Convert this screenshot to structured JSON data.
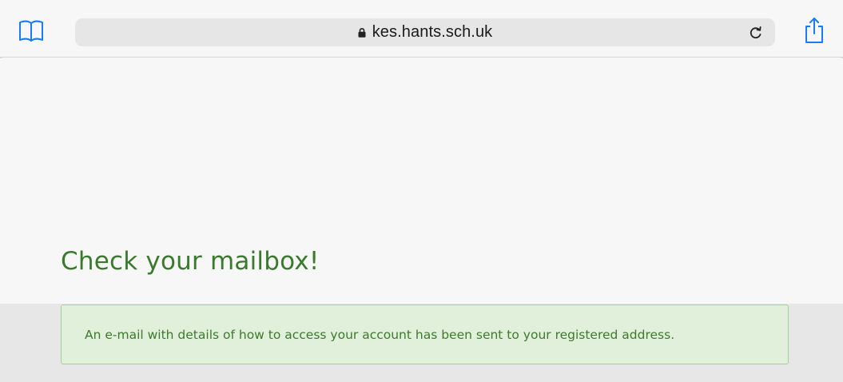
{
  "browser": {
    "url": "kes.hants.sch.uk",
    "icons": {
      "bookmarks": "book-icon",
      "lock": "lock-icon",
      "reload": "reload-icon",
      "share": "share-icon"
    },
    "accent_color": "#1a7cf5"
  },
  "page": {
    "heading": "Check your mailbox!",
    "alert": {
      "message": "An e-mail with details of how to access your account has been sent to your registered address.",
      "status": "success"
    },
    "colors": {
      "heading": "#3a7a2c",
      "alert_background": "#e1f0da",
      "alert_border": "#a6cf98",
      "alert_text": "#3c7a2c"
    }
  }
}
